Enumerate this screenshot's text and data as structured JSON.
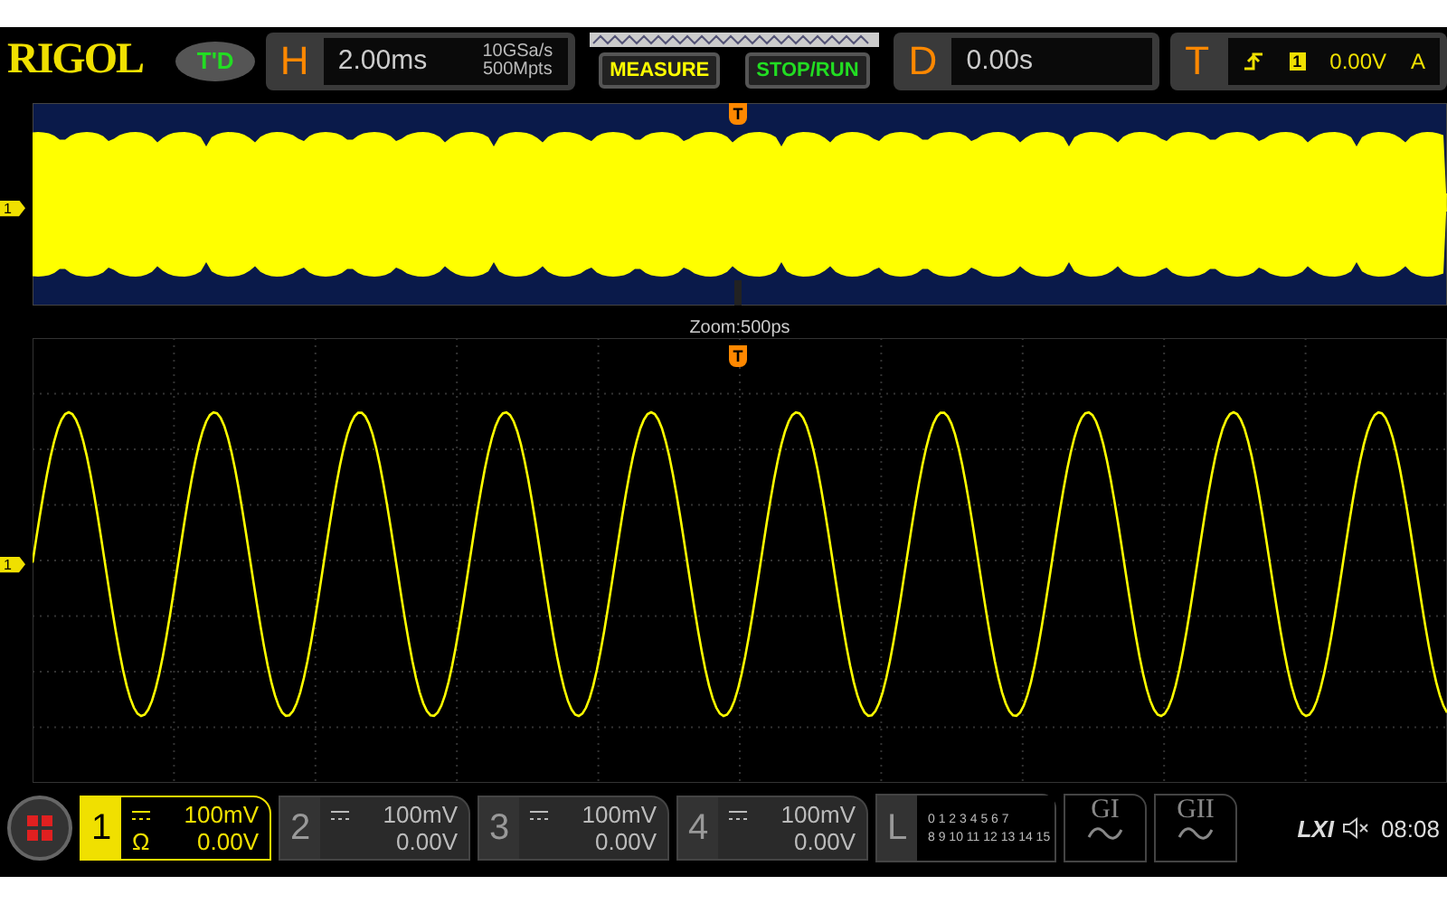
{
  "brand": "RIGOL",
  "run_status": "T'D",
  "horizontal": {
    "label": "H",
    "timebase": "2.00ms",
    "sample_rate": "10GSa/s",
    "memory_depth": "500Mpts"
  },
  "buttons": [
    {
      "label": "MEASURE",
      "kind": "measure"
    },
    {
      "label": "STOP/RUN",
      "kind": "run"
    }
  ],
  "delay": {
    "label": "D",
    "value": "0.00s"
  },
  "trigger": {
    "label": "T",
    "source": "1",
    "level": "0.00V",
    "mode": "A"
  },
  "overview": {
    "channel_marker": "1",
    "trigger_marker": "T"
  },
  "zoom": {
    "label": "Zoom:500ps",
    "channel_marker": "1",
    "trigger_marker": "T"
  },
  "channels": [
    {
      "number": "1",
      "scale": "100mV",
      "offset": "0.00V",
      "impedance": "Ω",
      "selected": true
    },
    {
      "number": "2",
      "scale": "100mV",
      "offset": "0.00V",
      "selected": false
    },
    {
      "number": "3",
      "scale": "100mV",
      "offset": "0.00V",
      "selected": false
    },
    {
      "number": "4",
      "scale": "100mV",
      "offset": "0.00V",
      "selected": false
    }
  ],
  "logic": {
    "label": "L",
    "row_1": "0 1 2 3 4 5 6 7",
    "row_2": "8 9 10 11 12 13 14 15"
  },
  "generators": [
    "GI",
    "GII"
  ],
  "status": {
    "lxi": "LXI",
    "time": "08:08"
  }
}
